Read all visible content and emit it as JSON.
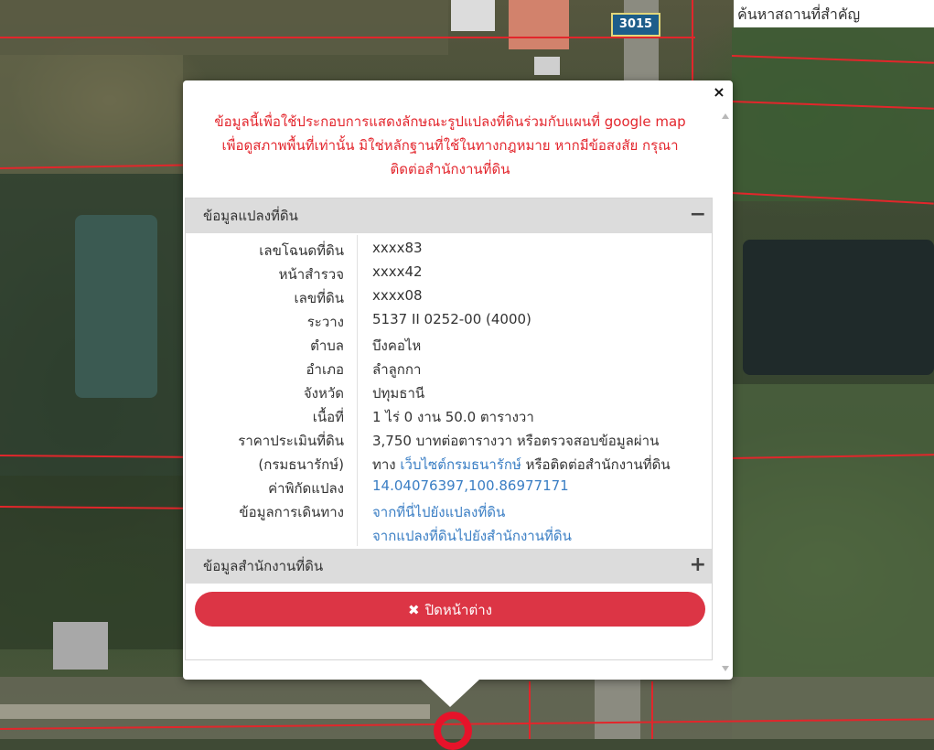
{
  "map": {
    "road_sign": "3015",
    "search": {
      "placeholder": "ค้นหาสถานที่สำคัญ",
      "value": ""
    }
  },
  "popup": {
    "close_symbol": "×",
    "disclaimer_lines": [
      "ข้อมูลนี้เพื่อใช้ประกอบการแสดงลักษณะรูปแปลงที่ดินร่วมกับแผนที่ google map",
      "เพื่อดูสภาพพื้นที่เท่านั้น มิใช่หลักฐานที่ใช้ในทางกฎหมาย หากมีข้อสงสัย กรุณา",
      "ติดต่อสำนักงานที่ดิน"
    ],
    "section_parcel": {
      "title": "ข้อมูลแปลงที่ดิน",
      "toggle": "−"
    },
    "rows": {
      "deed": {
        "label": "เลขโฉนดที่ดิน",
        "value": "xxxx83"
      },
      "survey": {
        "label": "หน้าสำรวจ",
        "value": "xxxx42"
      },
      "land": {
        "label": "เลขที่ดิน",
        "value": "xxxx08"
      },
      "map_sheet": {
        "label": "ระวาง",
        "value": "5137 II 0252-00 (4000)"
      },
      "subdistrict": {
        "label": "ตำบล",
        "value": "บึงคอไห"
      },
      "district": {
        "label": "อำเภอ",
        "value": "ลำลูกกา"
      },
      "province": {
        "label": "จังหวัด",
        "value": "ปทุมธานี"
      },
      "area": {
        "label": "เนื้อที่",
        "value": "1 ไร่ 0 งาน 50.0 ตารางวา"
      },
      "price": {
        "label_line1": "ราคาประเมินที่ดิน",
        "label_line2": "(กรมธนารักษ์)",
        "value_line1": "3,750 บาทต่อตารางวา หรือตรวจสอบข้อมูลผ่าน",
        "value_prefix": "ทาง ",
        "value_link": "เว็บไซต์กรมธนารักษ์",
        "value_suffix": " หรือติดต่อสำนักงานที่ดิน"
      },
      "coords": {
        "label": "ค่าพิกัดแปลง",
        "value": "14.04076397,100.86977171"
      },
      "travel": {
        "label": "ข้อมูลการเดินทาง",
        "link1": "จากที่นี่ไปยังแปลงที่ดิน",
        "link2": "จากแปลงที่ดินไปยังสำนักงานที่ดิน"
      }
    },
    "section_office": {
      "title": "ข้อมูลสำนักงานที่ดิน",
      "toggle": "+"
    },
    "close_button": {
      "icon": "✖",
      "label": "ปิดหน้าต่าง"
    }
  },
  "colors": {
    "disclaimer": "#e3262d",
    "link": "#3a7ec4",
    "close_button": "#dc3545",
    "parcel_line": "#e2262b",
    "marker": "#e6132a"
  }
}
